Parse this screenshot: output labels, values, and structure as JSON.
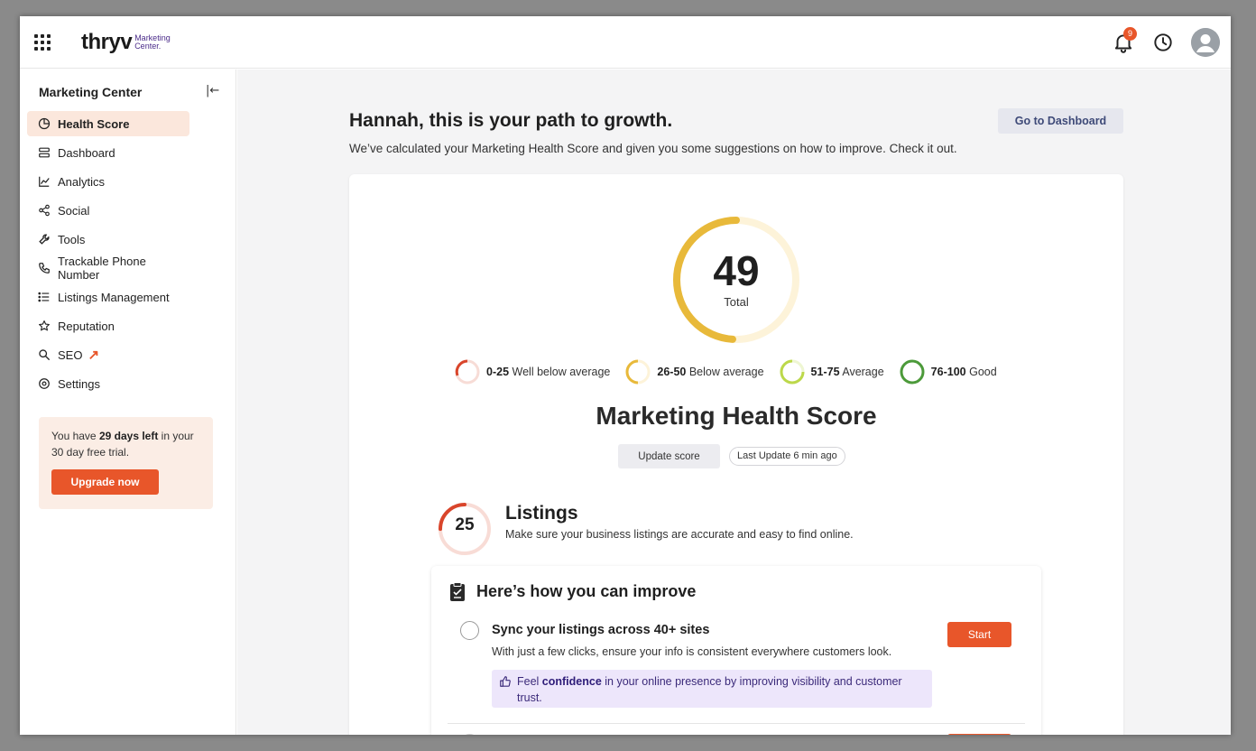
{
  "app": {
    "logo_word": "thryv",
    "logo_sub_line1": "Marketing",
    "logo_sub_line2": "Center.",
    "notification_count": "9",
    "accent_color": "#e8562a"
  },
  "sidebar": {
    "title": "Marketing Center",
    "collapse_icon": "collapse-left-icon",
    "items": [
      {
        "label": "Health Score",
        "icon": "pie-chart-icon",
        "active": true
      },
      {
        "label": "Dashboard",
        "icon": "stack-icon"
      },
      {
        "label": "Analytics",
        "icon": "line-chart-icon"
      },
      {
        "label": "Social",
        "icon": "share-icon"
      },
      {
        "label": "Tools",
        "icon": "wrench-icon"
      },
      {
        "label": "Trackable Phone Number",
        "icon": "phone-icon"
      },
      {
        "label": "Listings Management",
        "icon": "list-icon"
      },
      {
        "label": "Reputation",
        "icon": "star-icon"
      },
      {
        "label": "SEO",
        "icon": "search-icon"
      },
      {
        "label": "Settings",
        "icon": "gear-icon"
      }
    ],
    "trial": {
      "text_a": "You have ",
      "text_bold": "29 days left",
      "text_b": " in your 30 day free trial.",
      "button": "Upgrade now"
    }
  },
  "main": {
    "greeting": "Hannah, this is your path to growth.",
    "subtext": "We’ve calculated your Marketing Health Score and given you some suggestions on how to improve. Check it out.",
    "dashboard_button": "Go to Dashboard",
    "score": {
      "value": "49",
      "fraction": 0.49,
      "label": "Total",
      "color": "#e8b93a"
    },
    "legend": [
      {
        "range": "0-25",
        "label": "Well below average",
        "color": "#d9452b"
      },
      {
        "range": "26-50",
        "label": "Below average",
        "color": "#e8b93a"
      },
      {
        "range": "51-75",
        "label": "Average",
        "color": "#bcd84a"
      },
      {
        "range": "76-100",
        "label": "Good",
        "color": "#4c9a3a"
      }
    ],
    "section_title": "Marketing Health Score",
    "update_button": "Update score",
    "last_update": "Last Update 6 min ago",
    "listings": {
      "score": "25",
      "fraction": 0.25,
      "title": "Listings",
      "subtitle": "Make sure your business listings are accurate and easy to find online."
    },
    "improve": {
      "title": "Here’s how you can improve",
      "task": {
        "title": "Sync your listings across 40+ sites",
        "description": "With just a few clicks, ensure your info is consistent everywhere customers look.",
        "button": "Start",
        "tip_a": "Feel ",
        "tip_bold": "confidence",
        "tip_b": " in your online presence by improving visibility and customer trust."
      }
    }
  }
}
